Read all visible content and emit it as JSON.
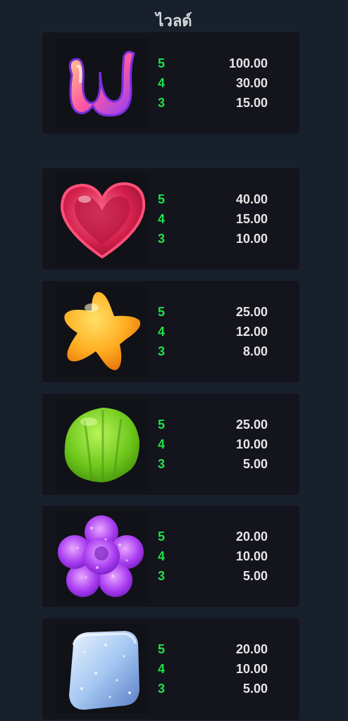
{
  "title": "ไวลด์",
  "symbols": [
    {
      "icon": "wild-candy-icon",
      "rows": [
        {
          "count": "5",
          "payout": "100.00"
        },
        {
          "count": "4",
          "payout": "30.00"
        },
        {
          "count": "3",
          "payout": "15.00"
        }
      ]
    },
    {
      "icon": "heart-candy-icon",
      "rows": [
        {
          "count": "5",
          "payout": "40.00"
        },
        {
          "count": "4",
          "payout": "15.00"
        },
        {
          "count": "3",
          "payout": "10.00"
        }
      ]
    },
    {
      "icon": "star-candy-icon",
      "rows": [
        {
          "count": "5",
          "payout": "25.00"
        },
        {
          "count": "4",
          "payout": "12.00"
        },
        {
          "count": "3",
          "payout": "8.00"
        }
      ]
    },
    {
      "icon": "green-gumdrop-icon",
      "rows": [
        {
          "count": "5",
          "payout": "25.00"
        },
        {
          "count": "4",
          "payout": "10.00"
        },
        {
          "count": "3",
          "payout": "5.00"
        }
      ]
    },
    {
      "icon": "purple-flower-candy-icon",
      "rows": [
        {
          "count": "5",
          "payout": "20.00"
        },
        {
          "count": "4",
          "payout": "10.00"
        },
        {
          "count": "3",
          "payout": "5.00"
        }
      ]
    },
    {
      "icon": "blue-sugar-cube-icon",
      "rows": [
        {
          "count": "5",
          "payout": "20.00"
        },
        {
          "count": "4",
          "payout": "10.00"
        },
        {
          "count": "3",
          "payout": "5.00"
        }
      ]
    }
  ],
  "colors": {
    "background": "#18202c",
    "card": "#14141c",
    "count": "#21e04a",
    "payout": "#e6e6e6"
  }
}
